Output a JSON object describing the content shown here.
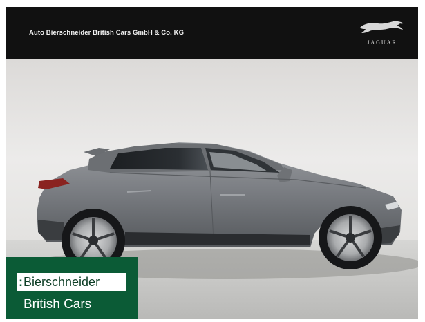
{
  "header": {
    "dealer_name": "Auto Bierschneider British Cars GmbH & Co. KG",
    "brand_wordmark": "JAGUAR",
    "logo_icon": "leaping-jaguar-icon",
    "background": "#111111"
  },
  "photo": {
    "subject": "grey-suv-side-view",
    "car_color": "#7a7d81",
    "wall_color": "#e4e2e0",
    "ground_color": "#c9c9c7"
  },
  "badge": {
    "wordmark": "Bierschneider",
    "subtitle": "British Cars",
    "background": "#0b5b36"
  }
}
